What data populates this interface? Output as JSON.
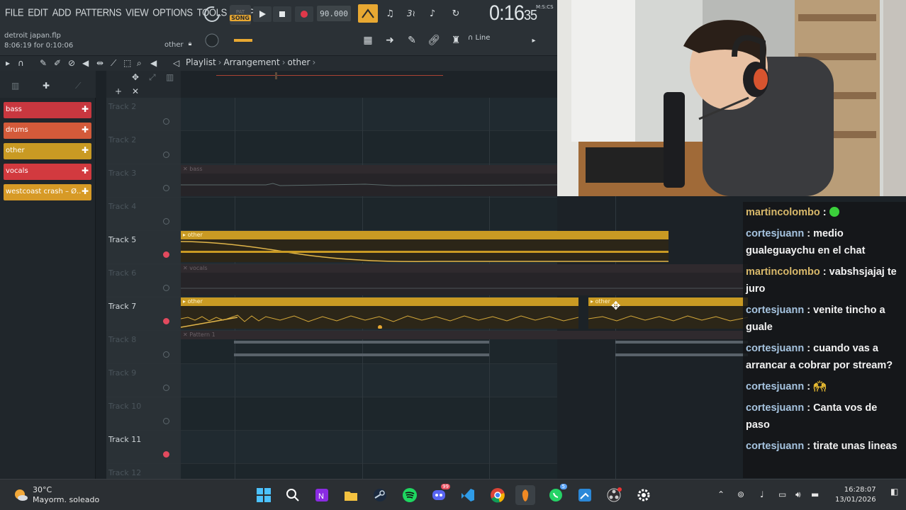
{
  "menu": [
    "FILE",
    "EDIT",
    "ADD",
    "PATTERNS",
    "VIEW",
    "OPTIONS",
    "TOOLS",
    "HELP"
  ],
  "project": {
    "filename": "detroit japan.flp",
    "duration": "8:06:19 for 0:10:06",
    "pattern_name": "other"
  },
  "transport": {
    "mode_pat": "PAT",
    "mode_song": "SONG",
    "tempo": "90.000",
    "time": "0:16",
    "time_sub": "35",
    "time_unit": "M:S:CS"
  },
  "snap": {
    "label": "Line"
  },
  "playlist": {
    "title": "Playlist",
    "section": "Arrangement",
    "pattern": "other"
  },
  "clips": [
    {
      "label": "bass",
      "color": "#c8373f"
    },
    {
      "label": "drums",
      "color": "#d35a3a"
    },
    {
      "label": "other",
      "color": "#c99a23"
    },
    {
      "label": "vocals",
      "color": "#d23a3f"
    },
    {
      "label": "westcoast crash – Ø..",
      "color": "#d79a26"
    }
  ],
  "tracks": [
    {
      "name": "Track 2",
      "active": false
    },
    {
      "name": "Track 2",
      "active": false
    },
    {
      "name": "Track 3",
      "active": false
    },
    {
      "name": "Track 4",
      "active": false
    },
    {
      "name": "Track 5",
      "active": true
    },
    {
      "name": "Track 6",
      "active": false
    },
    {
      "name": "Track 7",
      "active": true
    },
    {
      "name": "Track 8",
      "active": false
    },
    {
      "name": "Track 9",
      "active": false
    },
    {
      "name": "Track 10",
      "active": false
    },
    {
      "name": "Track 11",
      "active": true
    },
    {
      "name": "Track 12",
      "active": false
    }
  ],
  "lane_clips": {
    "bass_muted": "bass",
    "track5": "other",
    "vocals_muted": "vocals",
    "track7a": "other",
    "track7b": "other",
    "pattern_muted": "Pattern 1"
  },
  "chat": [
    {
      "user": "martincolombo",
      "text": ""
    },
    {
      "user": "cortesjuann",
      "text": "medio gualeguaychu en el chat"
    },
    {
      "user": "martincolombo",
      "text": "vabshsjajaj te juro"
    },
    {
      "user": "cortesjuann",
      "text": "venite tincho a guale"
    },
    {
      "user": "cortesjuann",
      "text": "cuando vas a arrancar a cobrar por stream?"
    },
    {
      "user": "cortesjuann",
      "text": ""
    },
    {
      "user": "cortesjuann",
      "text": "Canta vos de paso"
    },
    {
      "user": "cortesjuann",
      "text": "tirate unas lineas"
    }
  ],
  "taskbar": {
    "weather_temp": "30°C",
    "weather_desc": "Mayorm. soleado",
    "time": "16:28:07",
    "date": "13/01/2026",
    "badge1": "99",
    "badge2": "5"
  }
}
